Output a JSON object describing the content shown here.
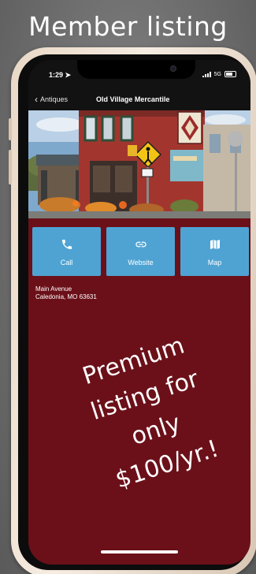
{
  "canvas": {
    "title": "Member listing"
  },
  "status_bar": {
    "time": "1:29",
    "network": "5G"
  },
  "nav": {
    "back_label": "Antiques",
    "title": "Old Village Mercantile"
  },
  "actions": [
    {
      "label": "Call",
      "icon": "phone-icon"
    },
    {
      "label": "Website",
      "icon": "link-icon"
    },
    {
      "label": "Map",
      "icon": "map-icon"
    }
  ],
  "address": {
    "line1": "Main Avenue",
    "line2": "Caledonia, MO 63631"
  },
  "promo": {
    "line1": "Premium",
    "line2": "listing for",
    "line3": "only",
    "line4": "$100/yr.!"
  },
  "colors": {
    "screen_background": "#6b1019",
    "button_accent": "#4fa3d3",
    "bars": "#121212"
  }
}
